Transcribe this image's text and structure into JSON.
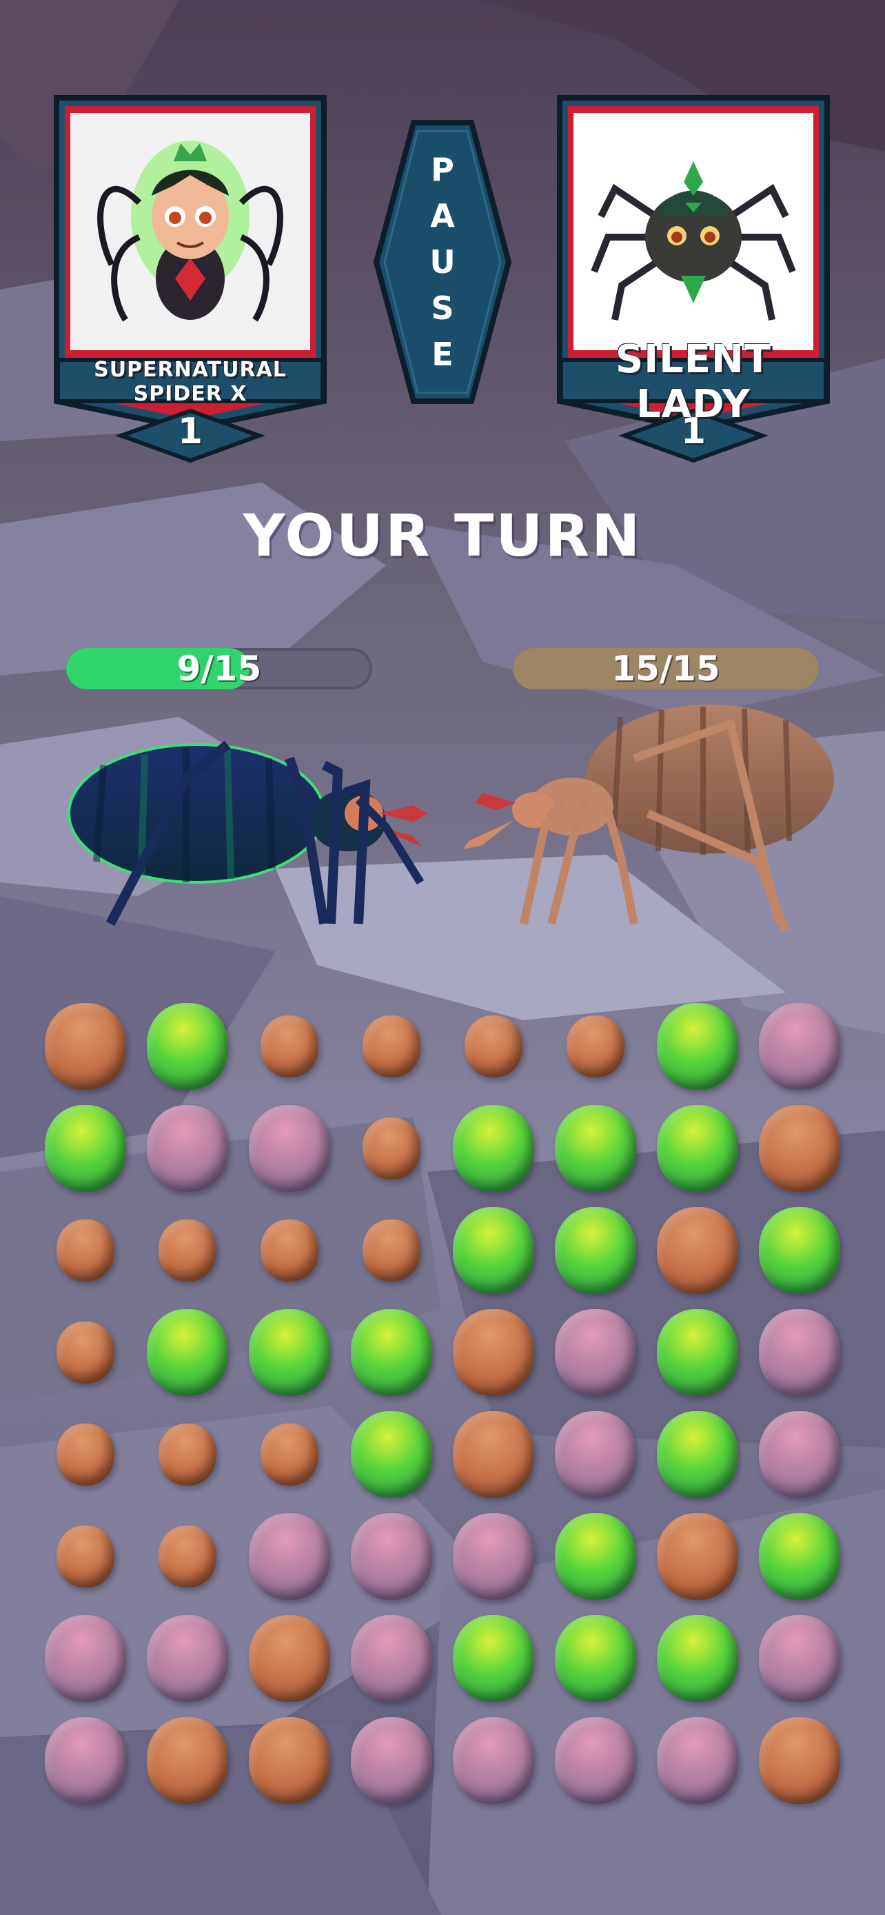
{
  "player": {
    "name": "SUPERNATURAL SPIDER X",
    "level": "1",
    "hp_text": "9/15",
    "hp_fraction": 0.6
  },
  "opponent": {
    "name": "SILENT LADY",
    "level": "1",
    "hp_text": "15/15",
    "hp_fraction": 1.0
  },
  "pause": {
    "letters": [
      "P",
      "A",
      "U",
      "S",
      "E"
    ]
  },
  "turn_text": "YOUR TURN",
  "colors": {
    "card_outer": "#1d4f6b",
    "card_red": "#cc2032",
    "card_inner": "#f1f1f1",
    "gem_green": "#3fcf49",
    "gem_orange": "#c9774c",
    "gem_pink": "#b985a6"
  },
  "board": {
    "legend": {
      "G": "green-gem",
      "O": "orange-gem",
      "P": "pink-gem",
      "o": "small-orange-gem"
    },
    "rows": [
      [
        "O",
        "G",
        "o",
        "o",
        "o",
        "o",
        "G",
        "P"
      ],
      [
        "G",
        "P",
        "P",
        "o",
        "G",
        "G",
        "G",
        "O"
      ],
      [
        "o",
        "o",
        "o",
        "o",
        "G",
        "G",
        "O",
        "G"
      ],
      [
        "o",
        "G",
        "G",
        "G",
        "O",
        "P",
        "G",
        "P"
      ],
      [
        "o",
        "o",
        "o",
        "G",
        "O",
        "P",
        "G",
        "P"
      ],
      [
        "o",
        "o",
        "P",
        "P",
        "P",
        "G",
        "O",
        "G"
      ],
      [
        "P",
        "P",
        "O",
        "P",
        "G",
        "G",
        "G",
        "P"
      ],
      [
        "P",
        "O",
        "O",
        "P",
        "P",
        "P",
        "P",
        "O"
      ]
    ]
  }
}
